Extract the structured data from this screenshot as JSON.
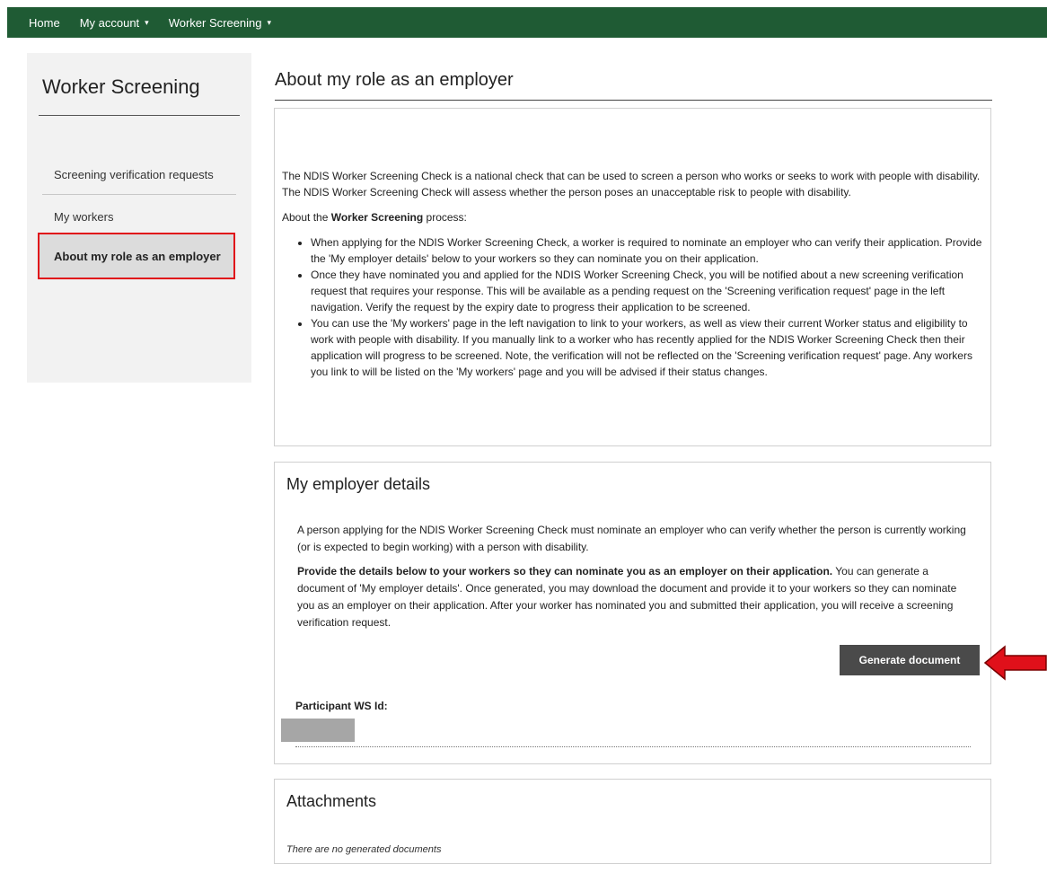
{
  "nav": {
    "home": "Home",
    "account": "My account",
    "screening": "Worker Screening"
  },
  "sidebar": {
    "title": "Worker Screening",
    "items": [
      {
        "label": "Screening verification requests"
      },
      {
        "label": "My workers"
      },
      {
        "label": "About my role as an employer"
      }
    ],
    "active_index": 2
  },
  "page": {
    "title": "About my role as an employer"
  },
  "about": {
    "intro": "The NDIS Worker Screening Check is a national check that can be used to screen a person who works or seeks to work with people with disability. The NDIS Worker Screening Check will assess whether the person poses an unacceptable risk to people with disability.",
    "process_prefix": "About the ",
    "process_bold": "Worker Screening",
    "process_suffix": " process:",
    "bullets": [
      "When applying for the NDIS Worker Screening Check, a worker is required to nominate an employer who can verify their application. Provide the 'My employer details' below to your workers so they can nominate you on their application.",
      "Once they have nominated you and applied for the NDIS Worker Screening Check, you will be notified about a new screening verification request that requires your response. This will be available as a pending request on the 'Screening verification request' page in the left navigation. Verify the request by the expiry date to progress their application to be screened.",
      "You can use the 'My workers' page in the left navigation to link to your workers, as well as view their current Worker status and eligibility to work with people with disability. If you manually link to a worker who has recently applied for the NDIS Worker Screening Check then their application will progress to be screened. Note, the verification will not be reflected on the 'Screening verification request' page. Any workers you link to will be listed on the 'My workers' page and you will be advised if their status changes."
    ]
  },
  "employer": {
    "heading": "My employer details",
    "para1": "A person applying for the NDIS Worker Screening Check must nominate an employer who can verify whether the person is currently working (or is expected to begin working) with a person with disability.",
    "para2_bold": "Provide the details below to your workers so they can nominate you as an employer on their application.",
    "para2_rest": " You can generate a document of 'My employer details'. Once generated, you may download the document and provide it to your workers so they can nominate you as an employer on their application. After your worker has nominated you and submitted their application, you will receive a screening verification request.",
    "button": "Generate document",
    "ws_label": "Participant WS Id:"
  },
  "attachments": {
    "heading": "Attachments",
    "empty": "There are no generated documents"
  },
  "colors": {
    "nav_bg": "#1f5b34",
    "highlight": "#e0101a",
    "button_bg": "#4a4a4a"
  }
}
